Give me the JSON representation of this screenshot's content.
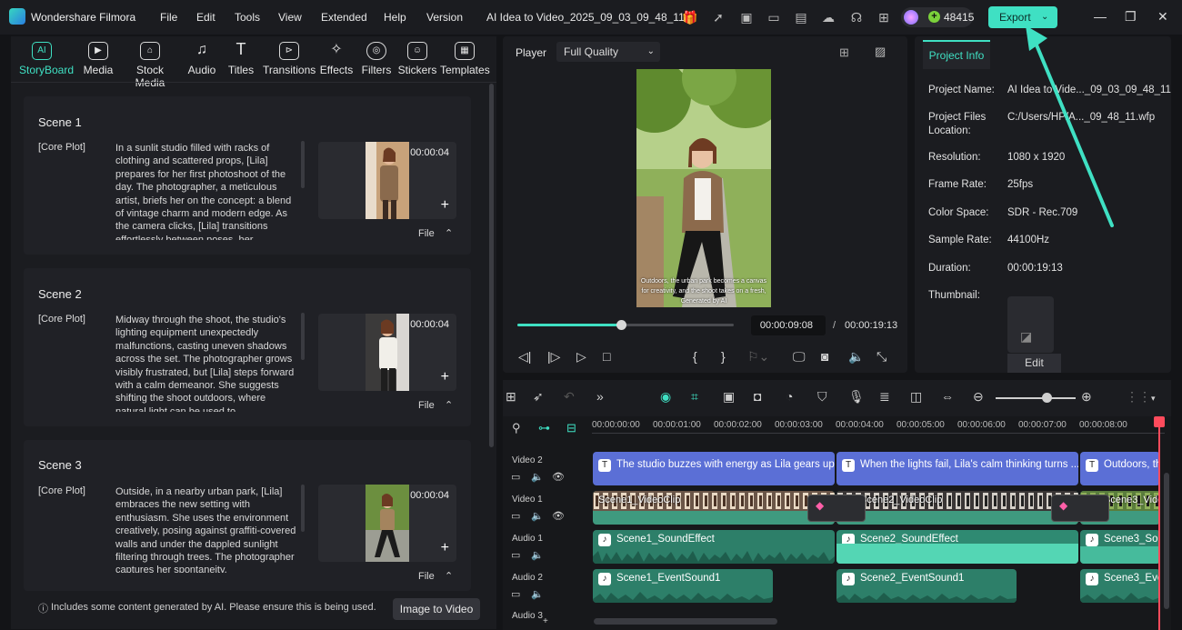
{
  "app": {
    "name": "Wondershare Filmora",
    "project_title": "AI Idea to Video_2025_09_03_09_48_11",
    "credits": "48415",
    "export_label": "Export"
  },
  "menu": [
    "File",
    "Edit",
    "Tools",
    "View",
    "Extended",
    "Help",
    "Version"
  ],
  "toolbar": [
    {
      "label": "StoryBoard",
      "icon": "ai-storyboard-icon",
      "active": true
    },
    {
      "label": "Media",
      "icon": "media-icon"
    },
    {
      "label": "Stock Media",
      "icon": "stock-media-icon"
    },
    {
      "label": "Audio",
      "icon": "audio-note-icon"
    },
    {
      "label": "Titles",
      "icon": "titles-icon"
    },
    {
      "label": "Transitions",
      "icon": "transitions-icon"
    },
    {
      "label": "Effects",
      "icon": "effects-icon"
    },
    {
      "label": "Filters",
      "icon": "filters-icon"
    },
    {
      "label": "Stickers",
      "icon": "stickers-icon"
    },
    {
      "label": "Templates",
      "icon": "templates-icon"
    }
  ],
  "scenes": [
    {
      "title": "Scene 1",
      "tag": "[Core Plot]",
      "text": "In a sunlit studio filled with racks of clothing and scattered props, [Lila] prepares for her first photoshoot of the day. The photographer, a meticulous artist, briefs her on the concept: a blend of vintage charm and modern edge. As the camera clicks, [Lila] transitions effortlessly between poses, her",
      "duration": "00:00:04",
      "file": "File"
    },
    {
      "title": "Scene 2",
      "tag": "[Core Plot]",
      "text": "Midway through the shoot, the studio's lighting equipment unexpectedly malfunctions, casting uneven shadows across the set. The photographer grows visibly frustrated, but [Lila] steps forward with a calm demeanor. She suggests shifting the shoot outdoors, where natural light can be used to",
      "duration": "00:00:04",
      "file": "File"
    },
    {
      "title": "Scene 3",
      "tag": "[Core Plot]",
      "text": "Outside, in a nearby urban park, [Lila] embraces the new setting with enthusiasm. She uses the environment creatively, posing against graffiti-covered walls and under the dappled sunlight filtering through trees. The photographer captures her spontaneity,",
      "duration": "00:00:04",
      "file": "File"
    }
  ],
  "left_footer": {
    "note": "Includes some content generated by AI. Please ensure this is being used.",
    "button": "Image to Video"
  },
  "player": {
    "label": "Player",
    "quality": "Full Quality",
    "subtitle": "Outdoors, the urban park becomes a canvas for creativity, and the shoot takes on a fresh, Generated by AI",
    "current_time": "00:00:09:08",
    "separator": "/",
    "total_time": "00:00:19:13",
    "progress": 0.48
  },
  "project_info": {
    "tab": "Project Info",
    "rows": [
      {
        "k": "Project Name:",
        "v": "AI Idea to Vide..._09_03_09_48_11"
      },
      {
        "k": "Project Files Location:",
        "v": "C:/Users/HP/A..._09_48_11.wfp"
      },
      {
        "k": "Resolution:",
        "v": "1080 x 1920"
      },
      {
        "k": "Frame Rate:",
        "v": "25fps"
      },
      {
        "k": "Color Space:",
        "v": "SDR - Rec.709"
      },
      {
        "k": "Sample Rate:",
        "v": "44100Hz"
      },
      {
        "k": "Duration:",
        "v": "00:00:19:13"
      },
      {
        "k": "Thumbnail:",
        "v": ""
      }
    ],
    "edit": "Edit"
  },
  "timeline": {
    "ticks": [
      "00:00:00:00",
      "00:00:01:00",
      "00:00:02:00",
      "00:00:03:00",
      "00:00:04:00",
      "00:00:05:00",
      "00:00:06:00",
      "00:00:07:00",
      "00:00:08:00"
    ],
    "tracks": [
      {
        "name": "Video 2",
        "clips": [
          "The studio buzzes with energy as Lila gears up...",
          "When the lights fail, Lila's calm thinking turns ...",
          "Outdoors, th"
        ]
      },
      {
        "name": "Video 1",
        "clips": [
          "Scene1_VideoClip",
          "Scene2_VideoClip",
          "Scene3_Vide"
        ]
      },
      {
        "name": "Audio 1",
        "clips": [
          "Scene1_SoundEffect",
          "Scene2_SoundEffect",
          "Scene3_Sou"
        ]
      },
      {
        "name": "Audio 2",
        "clips": [
          "Scene1_EventSound1",
          "Scene2_EventSound1",
          "Scene3_Even"
        ]
      },
      {
        "name": "Audio 3",
        "clips": []
      }
    ]
  },
  "colors": {
    "accent": "#3fe0c3",
    "title_clip": "#5b6fd6",
    "audio_clip": "#2d7f69",
    "playhead": "#ff4b5c"
  }
}
